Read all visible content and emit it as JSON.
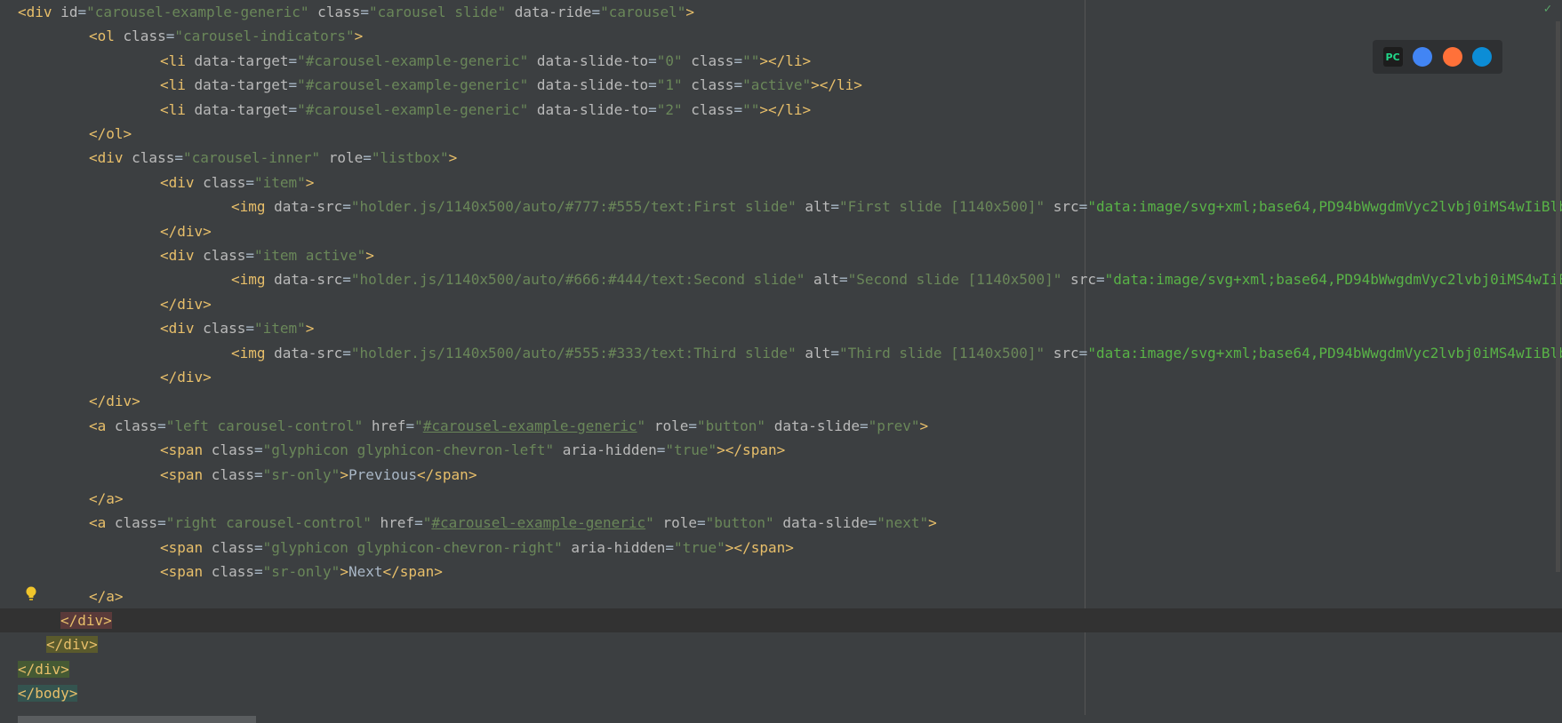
{
  "editor": {
    "lines": [
      {
        "indent": 0,
        "parts": [
          [
            "<",
            "tag"
          ],
          [
            "div",
            "tag"
          ],
          [
            " id",
            "attr"
          ],
          [
            "=",
            "text"
          ],
          [
            "\"carousel-example-generic\"",
            "val"
          ],
          [
            " class",
            "attr"
          ],
          [
            "=",
            "text"
          ],
          [
            "\"carousel slide\"",
            "val"
          ],
          [
            " data-ride",
            "attr"
          ],
          [
            "=",
            "text"
          ],
          [
            "\"carousel\"",
            "val"
          ],
          [
            ">",
            "tag"
          ]
        ]
      },
      {
        "indent": 1,
        "parts": [
          [
            "<ol",
            "tag"
          ],
          [
            " class",
            "attr"
          ],
          [
            "=",
            "text"
          ],
          [
            "\"carousel-indicators\"",
            "val"
          ],
          [
            ">",
            "tag"
          ]
        ]
      },
      {
        "indent": 2,
        "parts": [
          [
            "<li",
            "tag"
          ],
          [
            " data-target",
            "attr"
          ],
          [
            "=",
            "text"
          ],
          [
            "\"#carousel-example-generic\"",
            "val"
          ],
          [
            " data-slide-to",
            "attr"
          ],
          [
            "=",
            "text"
          ],
          [
            "\"0\"",
            "val"
          ],
          [
            " class",
            "attr"
          ],
          [
            "=",
            "text"
          ],
          [
            "\"\"",
            "val"
          ],
          [
            "></li>",
            "tag"
          ]
        ]
      },
      {
        "indent": 2,
        "parts": [
          [
            "<li",
            "tag"
          ],
          [
            " data-target",
            "attr"
          ],
          [
            "=",
            "text"
          ],
          [
            "\"#carousel-example-generic\"",
            "val"
          ],
          [
            " data-slide-to",
            "attr"
          ],
          [
            "=",
            "text"
          ],
          [
            "\"1\"",
            "val"
          ],
          [
            " class",
            "attr"
          ],
          [
            "=",
            "text"
          ],
          [
            "\"active\"",
            "val"
          ],
          [
            "></li>",
            "tag"
          ]
        ]
      },
      {
        "indent": 2,
        "parts": [
          [
            "<li",
            "tag"
          ],
          [
            " data-target",
            "attr"
          ],
          [
            "=",
            "text"
          ],
          [
            "\"#carousel-example-generic\"",
            "val"
          ],
          [
            " data-slide-to",
            "attr"
          ],
          [
            "=",
            "text"
          ],
          [
            "\"2\"",
            "val"
          ],
          [
            " class",
            "attr"
          ],
          [
            "=",
            "text"
          ],
          [
            "\"\"",
            "val"
          ],
          [
            "></li>",
            "tag"
          ]
        ]
      },
      {
        "indent": 1,
        "parts": [
          [
            "</ol>",
            "tag"
          ]
        ]
      },
      {
        "indent": 1,
        "parts": [
          [
            "<div",
            "tag"
          ],
          [
            " class",
            "attr"
          ],
          [
            "=",
            "text"
          ],
          [
            "\"carousel-inner\"",
            "val"
          ],
          [
            " role",
            "attr"
          ],
          [
            "=",
            "text"
          ],
          [
            "\"listbox\"",
            "val"
          ],
          [
            ">",
            "tag"
          ]
        ]
      },
      {
        "indent": 2,
        "parts": [
          [
            "<div",
            "tag"
          ],
          [
            " class",
            "attr"
          ],
          [
            "=",
            "text"
          ],
          [
            "\"item\"",
            "val"
          ],
          [
            ">",
            "tag"
          ]
        ]
      },
      {
        "indent": 3,
        "parts": [
          [
            "<img",
            "tag"
          ],
          [
            " data-src",
            "attr"
          ],
          [
            "=",
            "text"
          ],
          [
            "\"holder.js/1140x500/auto/#777:#555/text:First slide\"",
            "val"
          ],
          [
            " alt",
            "attr"
          ],
          [
            "=",
            "text"
          ],
          [
            "\"First slide [1140x500]\"",
            "val"
          ],
          [
            " src",
            "attr"
          ],
          [
            "=",
            "text"
          ],
          [
            "\"data:image/svg+xml;base64,PD94bWwgdmVyc2lvbj0iMS4wIiBlbmNvZGl",
            "valgreen"
          ]
        ]
      },
      {
        "indent": 2,
        "parts": [
          [
            "</div>",
            "tag"
          ]
        ]
      },
      {
        "indent": 2,
        "parts": [
          [
            "<div",
            "tag"
          ],
          [
            " class",
            "attr"
          ],
          [
            "=",
            "text"
          ],
          [
            "\"item active\"",
            "val"
          ],
          [
            ">",
            "tag"
          ]
        ]
      },
      {
        "indent": 3,
        "parts": [
          [
            "<img",
            "tag"
          ],
          [
            " data-src",
            "attr"
          ],
          [
            "=",
            "text"
          ],
          [
            "\"holder.js/1140x500/auto/#666:#444/text:Second slide\"",
            "val"
          ],
          [
            " alt",
            "attr"
          ],
          [
            "=",
            "text"
          ],
          [
            "\"Second slide [1140x500]\"",
            "val"
          ],
          [
            " src",
            "attr"
          ],
          [
            "=",
            "text"
          ],
          [
            "\"data:image/svg+xml;base64,PD94bWwgdmVyc2lvbj0iMS4wIiBlbmNvZ",
            "valgreen"
          ]
        ]
      },
      {
        "indent": 2,
        "parts": [
          [
            "</div>",
            "tag"
          ]
        ]
      },
      {
        "indent": 2,
        "parts": [
          [
            "<div",
            "tag"
          ],
          [
            " class",
            "attr"
          ],
          [
            "=",
            "text"
          ],
          [
            "\"item\"",
            "val"
          ],
          [
            ">",
            "tag"
          ]
        ]
      },
      {
        "indent": 3,
        "parts": [
          [
            "<img",
            "tag"
          ],
          [
            " data-src",
            "attr"
          ],
          [
            "=",
            "text"
          ],
          [
            "\"holder.js/1140x500/auto/#555:#333/text:Third slide\"",
            "val"
          ],
          [
            " alt",
            "attr"
          ],
          [
            "=",
            "text"
          ],
          [
            "\"Third slide [1140x500]\"",
            "val"
          ],
          [
            " src",
            "attr"
          ],
          [
            "=",
            "text"
          ],
          [
            "\"data:image/svg+xml;base64,PD94bWwgdmVyc2lvbj0iMS4wIiBlbmNvZGl",
            "valgreen"
          ]
        ]
      },
      {
        "indent": 2,
        "parts": [
          [
            "</div>",
            "tag"
          ]
        ]
      },
      {
        "indent": 1,
        "parts": [
          [
            "</div>",
            "tag"
          ]
        ]
      },
      {
        "indent": 1,
        "parts": [
          [
            "<a",
            "tag"
          ],
          [
            " class",
            "attr"
          ],
          [
            "=",
            "text"
          ],
          [
            "\"left carousel-control\"",
            "val"
          ],
          [
            " href",
            "attr"
          ],
          [
            "=",
            "text"
          ],
          [
            "\"",
            "val"
          ],
          [
            "#carousel-example-generic",
            "link"
          ],
          [
            "\"",
            "val"
          ],
          [
            " role",
            "attr"
          ],
          [
            "=",
            "text"
          ],
          [
            "\"button\"",
            "val"
          ],
          [
            " data-slide",
            "attr"
          ],
          [
            "=",
            "text"
          ],
          [
            "\"prev\"",
            "val"
          ],
          [
            ">",
            "tag"
          ]
        ]
      },
      {
        "indent": 2,
        "parts": [
          [
            "<span",
            "tag"
          ],
          [
            " class",
            "attr"
          ],
          [
            "=",
            "text"
          ],
          [
            "\"glyphicon glyphicon-chevron-left\"",
            "val"
          ],
          [
            " aria-hidden",
            "attr"
          ],
          [
            "=",
            "text"
          ],
          [
            "\"true\"",
            "val"
          ],
          [
            "></span>",
            "tag"
          ]
        ]
      },
      {
        "indent": 2,
        "parts": [
          [
            "<span",
            "tag"
          ],
          [
            " class",
            "attr"
          ],
          [
            "=",
            "text"
          ],
          [
            "\"sr-only\"",
            "val"
          ],
          [
            ">",
            "tag"
          ],
          [
            "Previous",
            "text"
          ],
          [
            "</span>",
            "tag"
          ]
        ]
      },
      {
        "indent": 1,
        "parts": [
          [
            "</a>",
            "tag"
          ]
        ]
      },
      {
        "indent": 1,
        "parts": [
          [
            "<a",
            "tag"
          ],
          [
            " class",
            "attr"
          ],
          [
            "=",
            "text"
          ],
          [
            "\"right carousel-control\"",
            "val"
          ],
          [
            " href",
            "attr"
          ],
          [
            "=",
            "text"
          ],
          [
            "\"",
            "val"
          ],
          [
            "#carousel-example-generic",
            "link"
          ],
          [
            "\"",
            "val"
          ],
          [
            " role",
            "attr"
          ],
          [
            "=",
            "text"
          ],
          [
            "\"button\"",
            "val"
          ],
          [
            " data-slide",
            "attr"
          ],
          [
            "=",
            "text"
          ],
          [
            "\"next\"",
            "val"
          ],
          [
            ">",
            "tag"
          ]
        ]
      },
      {
        "indent": 2,
        "parts": [
          [
            "<span",
            "tag"
          ],
          [
            " class",
            "attr"
          ],
          [
            "=",
            "text"
          ],
          [
            "\"glyphicon glyphicon-chevron-right\"",
            "val"
          ],
          [
            " aria-hidden",
            "attr"
          ],
          [
            "=",
            "text"
          ],
          [
            "\"true\"",
            "val"
          ],
          [
            "></span>",
            "tag"
          ]
        ]
      },
      {
        "indent": 2,
        "parts": [
          [
            "<span",
            "tag"
          ],
          [
            " class",
            "attr"
          ],
          [
            "=",
            "text"
          ],
          [
            "\"sr-only\"",
            "val"
          ],
          [
            ">",
            "tag"
          ],
          [
            "Next",
            "text"
          ],
          [
            "</span>",
            "tag"
          ]
        ]
      },
      {
        "indent": 1,
        "parts": [
          [
            "</a>",
            "tag"
          ]
        ]
      },
      {
        "indent": 0.6,
        "current": true,
        "parts": [
          [
            "</div>",
            "tag hl-red-close"
          ]
        ]
      },
      {
        "indent": 0.4,
        "parts": [
          [
            "</div>",
            "tag hl-olive"
          ]
        ]
      },
      {
        "indent": 0,
        "parts": [
          [
            "</div>",
            "tag hl-green"
          ]
        ]
      },
      {
        "indent": 0,
        "parts": [
          [
            "</body>",
            "tag hl-teal"
          ]
        ]
      }
    ]
  },
  "browsers": [
    {
      "name": "pycharm-icon",
      "label": "PC",
      "color": "#1d1d1d",
      "fg": "#21d789"
    },
    {
      "name": "chrome-icon",
      "label": "",
      "color": "#4285f4",
      "fg": "#fff"
    },
    {
      "name": "firefox-icon",
      "label": "",
      "color": "#ff7139",
      "fg": "#fff"
    },
    {
      "name": "edge-icon",
      "label": "",
      "color": "#0c8dd6",
      "fg": "#fff"
    }
  ],
  "colors": {
    "background": "#3c3f41",
    "tag": "#e8bf6a",
    "attribute": "#bababa",
    "value": "#6a8759"
  }
}
